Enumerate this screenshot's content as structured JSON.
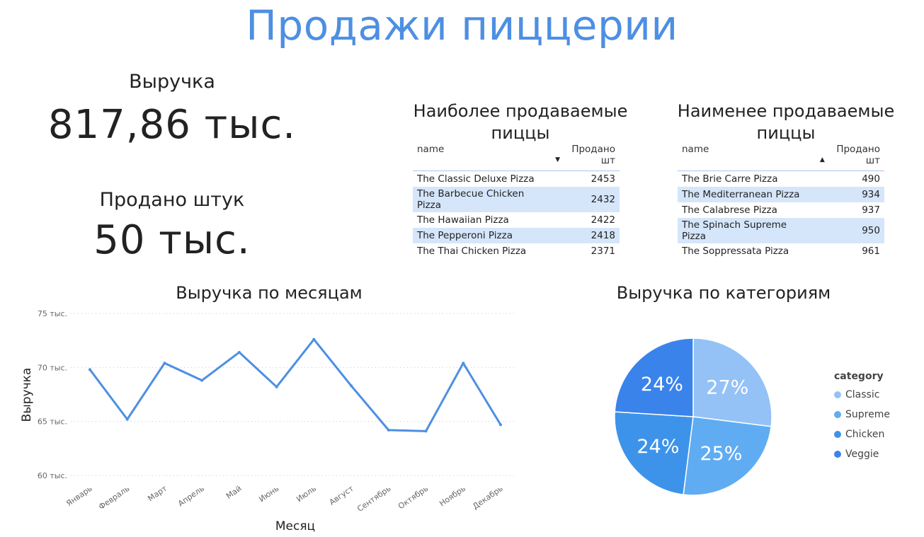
{
  "title": "Продажи пиццерии",
  "kpis": {
    "revenue_label": "Выручка",
    "revenue_value": "817,86 тыс.",
    "units_label": "Продано штук",
    "units_value": "50 тыс."
  },
  "top_table": {
    "title": "Наиболее продаваемые пиццы",
    "col_name": "name",
    "col_sold": "Продано шт",
    "sort": "desc",
    "rows": [
      {
        "name": "The Classic Deluxe Pizza",
        "sold": "2453"
      },
      {
        "name": "The Barbecue Chicken Pizza",
        "sold": "2432"
      },
      {
        "name": "The Hawaiian Pizza",
        "sold": "2422"
      },
      {
        "name": "The Pepperoni Pizza",
        "sold": "2418"
      },
      {
        "name": "The Thai Chicken Pizza",
        "sold": "2371"
      }
    ]
  },
  "bottom_table": {
    "title": "Наименее продаваемые пиццы",
    "col_name": "name",
    "col_sold": "Продано шт",
    "sort": "asc",
    "rows": [
      {
        "name": "The Brie Carre Pizza",
        "sold": "490"
      },
      {
        "name": "The Mediterranean Pizza",
        "sold": "934"
      },
      {
        "name": "The Calabrese Pizza",
        "sold": "937"
      },
      {
        "name": "The Spinach Supreme Pizza",
        "sold": "950"
      },
      {
        "name": "The Soppressata Pizza",
        "sold": "961"
      }
    ]
  },
  "chart_data": [
    {
      "type": "line",
      "title": "Выручка по месяцам",
      "xlabel": "Месяц",
      "ylabel": "Выручка",
      "categories": [
        "Январь",
        "Февраль",
        "Март",
        "Апрель",
        "Май",
        "Июнь",
        "Июль",
        "Август",
        "Сентябрь",
        "Октябрь",
        "Ноябрь",
        "Декабрь"
      ],
      "values": [
        69.8,
        65.2,
        70.4,
        68.8,
        71.4,
        68.2,
        72.6,
        68.3,
        64.2,
        64.1,
        70.4,
        64.7
      ],
      "ylim": [
        60,
        75
      ],
      "yticks": [
        {
          "value": 75,
          "label": "75 тыс."
        },
        {
          "value": 70,
          "label": "70 тыс."
        },
        {
          "value": 65,
          "label": "65 тыс."
        },
        {
          "value": 60,
          "label": "60 тыс."
        }
      ],
      "grid": true,
      "color": "#4d8fe3"
    },
    {
      "type": "pie",
      "title": "Выручка по категориям",
      "legend_title": "category",
      "legend_position": "right",
      "slices": [
        {
          "name": "Classic",
          "value": 27,
          "label": "27%",
          "color": "#94c2f6"
        },
        {
          "name": "Supreme",
          "value": 25,
          "label": "25%",
          "color": "#60acf2"
        },
        {
          "name": "Chicken",
          "value": 24,
          "label": "24%",
          "color": "#3d93e9"
        },
        {
          "name": "Veggie",
          "value": 24,
          "label": "24%",
          "color": "#3a83ea"
        }
      ]
    }
  ]
}
